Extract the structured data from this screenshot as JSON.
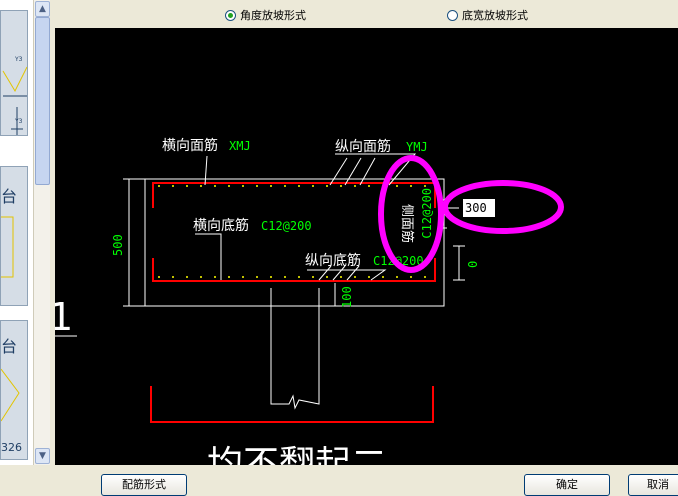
{
  "radio_options": [
    {
      "label": "角度放坡形式",
      "selected": true
    },
    {
      "label": "底宽放坡形式",
      "selected": false
    }
  ],
  "thumbnails": [
    {
      "label": ""
    },
    {
      "label": "台"
    },
    {
      "label": "台"
    }
  ],
  "thumb_number": "326",
  "drawing": {
    "labels": {
      "top_transverse": "横向面筋",
      "top_transverse_value": "XMJ",
      "top_longitudinal": "纵向面筋",
      "top_longitudinal_value": "YMJ",
      "bottom_transverse": "横向底筋",
      "bottom_transverse_value": "C12@200",
      "bottom_longitudinal": "纵向底筋",
      "bottom_longitudinal_value": "C12@200",
      "side_bar": "侧面筋",
      "side_bar_value": "C12@200"
    },
    "dims": {
      "height": "500",
      "cover": "100",
      "offset": "0"
    },
    "big_glyph": "1",
    "bottom_text": "均不翻起二"
  },
  "dim_input_value": "300",
  "colors": {
    "rebar_value": "#00ff00",
    "rebar_frame": "#ff0000",
    "highlight": "#ff00ff",
    "dim": "#00ff00"
  },
  "buttons": {
    "rebar_form": "配筋形式",
    "ok": "确定",
    "cancel": "取消"
  }
}
